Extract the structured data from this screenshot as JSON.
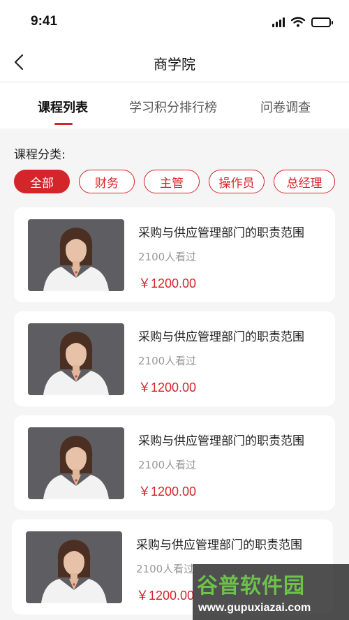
{
  "status_bar": {
    "time": "9:41"
  },
  "navbar": {
    "title": "商学院"
  },
  "tabs": [
    {
      "label": "课程列表",
      "active": true
    },
    {
      "label": "学习积分排行榜",
      "active": false
    },
    {
      "label": "问卷调查",
      "active": false
    }
  ],
  "category": {
    "label": "课程分类:",
    "chips": [
      {
        "label": "全部",
        "active": true
      },
      {
        "label": "财务",
        "active": false
      },
      {
        "label": "主管",
        "active": false
      },
      {
        "label": "操作员",
        "active": false
      },
      {
        "label": "总经理",
        "active": false
      }
    ]
  },
  "courses": [
    {
      "title": "采购与供应管理部门的职责范围",
      "views": "2100人看过",
      "price": "￥1200.00"
    },
    {
      "title": "采购与供应管理部门的职责范围",
      "views": "2100人看过",
      "price": "￥1200.00"
    },
    {
      "title": "采购与供应管理部门的职责范围",
      "views": "2100人看过",
      "price": "￥1200.00"
    },
    {
      "title": "采购与供应管理部门的职责范围",
      "views": "2100人看过",
      "price": "￥1200.00"
    }
  ],
  "watermark": {
    "name": "谷普软件园",
    "url": "www.gupuxiazai.com"
  },
  "colors": {
    "accent": "#d4252b",
    "background": "#f5f5f5"
  }
}
